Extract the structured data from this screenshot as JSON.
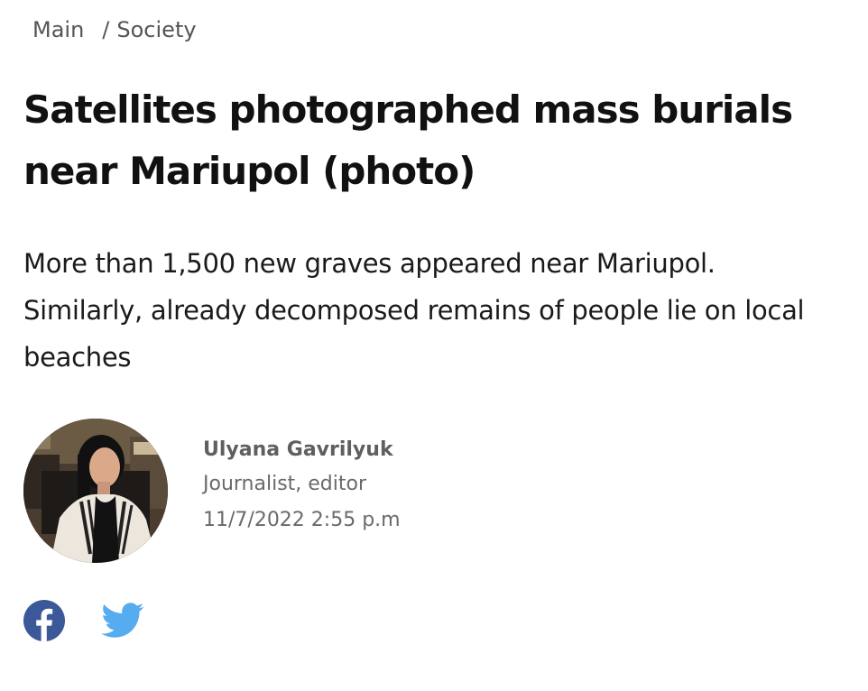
{
  "breadcrumb": {
    "items": [
      {
        "label": "Main"
      },
      {
        "label": "Society"
      }
    ],
    "separator": "/"
  },
  "article": {
    "title": "Satellites photographed mass burials near Mariupol (photo)",
    "lead": "More than 1,500 new graves appeared near Mariupol. Similarly, already decomposed remains of people lie on local beaches"
  },
  "author": {
    "name": "Ulyana Gavrilyuk",
    "role": "Journalist, editor",
    "date": "11/7/2022 2:55 p.m",
    "avatar": "author-photo"
  },
  "share": {
    "buttons": [
      {
        "name": "facebook",
        "icon": "facebook-icon",
        "color": "#3b5998"
      },
      {
        "name": "twitter",
        "icon": "twitter-icon",
        "color": "#55acee"
      }
    ]
  },
  "colors": {
    "text": "#111111",
    "muted": "#6a6a6a",
    "breadcrumb": "#555555"
  }
}
